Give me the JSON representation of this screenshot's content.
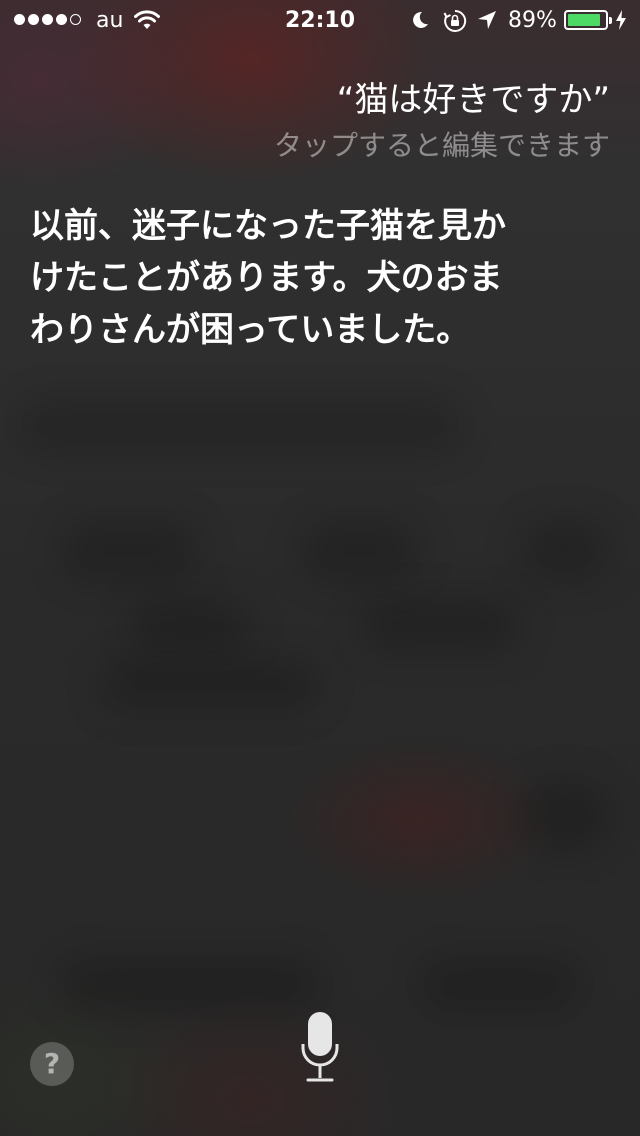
{
  "status_bar": {
    "carrier": "au",
    "time": "22:10",
    "battery_percent": "89%",
    "battery_level": 0.89,
    "signal_bars_filled": 4,
    "signal_bars_total": 5,
    "battery_color": "#4cd964"
  },
  "siri": {
    "query": "“猫は好きですか”",
    "edit_hint": "タップすると編集できます",
    "answer": "以前、迷子になった子猫を見かけたことがあります。犬のおまわりさんが困っていました。",
    "help_label": "?"
  },
  "icons": {
    "wifi": "wifi-icon",
    "moon": "do-not-disturb-moon-icon",
    "rotation_lock": "rotation-lock-icon",
    "location": "location-arrow-icon",
    "charging": "charging-bolt-icon",
    "mic": "microphone-icon"
  }
}
